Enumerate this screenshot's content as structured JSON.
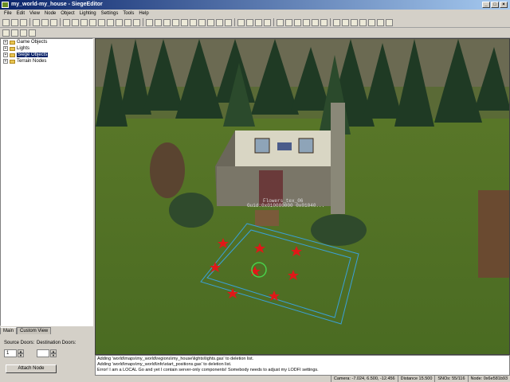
{
  "window": {
    "title": "my_world-my_house - SiegeEditor"
  },
  "menu": [
    "File",
    "Edit",
    "View",
    "Node",
    "Object",
    "Lighting",
    "Settings",
    "Tools",
    "Help"
  ],
  "tree": {
    "items": [
      {
        "label": "Game Objects",
        "selected": false
      },
      {
        "label": "Lights",
        "selected": false
      },
      {
        "label": "Siege Objects",
        "selected": true
      },
      {
        "label": "Terrain Nodes",
        "selected": false
      }
    ]
  },
  "tabs": {
    "main": "Main",
    "custom": "Custom View"
  },
  "doors": {
    "source_label": "Source Doors:",
    "dest_label": "Destination Doors:",
    "source_value": "1",
    "dest_value": "",
    "attach_label": "Attach Node"
  },
  "viewport": {
    "object_label": "Flowers_tex_06",
    "object_guid": "Guid:0x010000000 0x01040..."
  },
  "console": {
    "lines": [
      "Adding 'world\\maps\\my_world\\regions\\my_house\\lights\\lights.gas' to deletion list.",
      "Adding 'world\\maps\\my_world\\info\\start_positions.gas' to deletion list.",
      "Error! I am a LOCAL Go and yet I contain server-only components! Somebody needs to adjust my LODFI settings."
    ]
  },
  "status": {
    "camera": "Camera: -7.024, 6.500, -12.456",
    "distance": "Distance 15.500",
    "snos": "SNOs: 55/116",
    "node": "Node: 0x6e581b93"
  },
  "colors": {
    "titlebar": "#0a246a",
    "marker": "#e01818",
    "selection": "#3a6ea5"
  }
}
